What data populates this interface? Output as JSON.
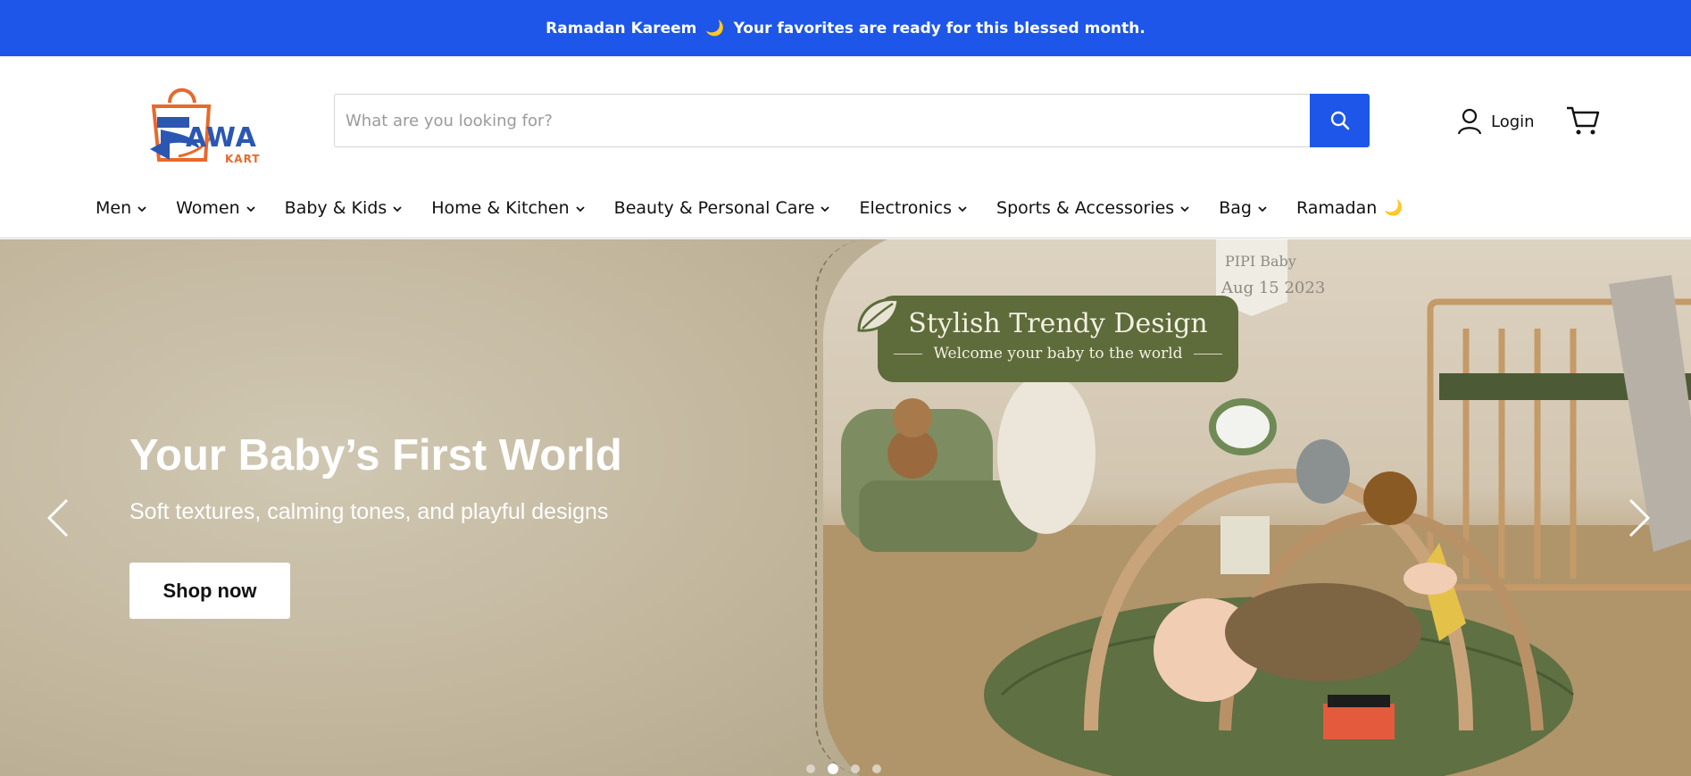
{
  "announcement": {
    "text_before": "Ramadan Kareem",
    "emoji": "🌙",
    "text_after": "Your favorites are ready for this blessed month."
  },
  "brand": {
    "name": "AWA",
    "sub": "KART",
    "colors": {
      "primary": "#1d56e8",
      "logo_blue": "#2b57b3",
      "logo_orange": "#e8692a"
    }
  },
  "search": {
    "value": "",
    "placeholder": "What are you looking for?",
    "button_icon": "search-icon"
  },
  "account": {
    "login_label": "Login",
    "icon": "user-icon"
  },
  "cart": {
    "icon": "cart-icon"
  },
  "nav": {
    "items": [
      {
        "label": "Men"
      },
      {
        "label": "Women"
      },
      {
        "label": "Baby & Kids"
      },
      {
        "label": "Home & Kitchen"
      },
      {
        "label": "Beauty & Personal Care"
      },
      {
        "label": "Electronics"
      },
      {
        "label": "Sports & Accessories"
      },
      {
        "label": "Bag"
      },
      {
        "label": "Ramadan",
        "emoji": "🌙"
      }
    ]
  },
  "hero": {
    "title": "Your Baby’s First World",
    "subtitle": "Soft textures, calming tones, and playful designs",
    "cta_label": "Shop now",
    "badge_title": "Stylish Trendy Design",
    "badge_subtitle": "Welcome your baby to the world",
    "photo_text_1": "PIPI Baby",
    "photo_text_2": "Aug 15 2023",
    "prev_icon": "chevron-left-icon",
    "next_icon": "chevron-right-icon",
    "slide_count": 4,
    "active_slide": 2
  }
}
